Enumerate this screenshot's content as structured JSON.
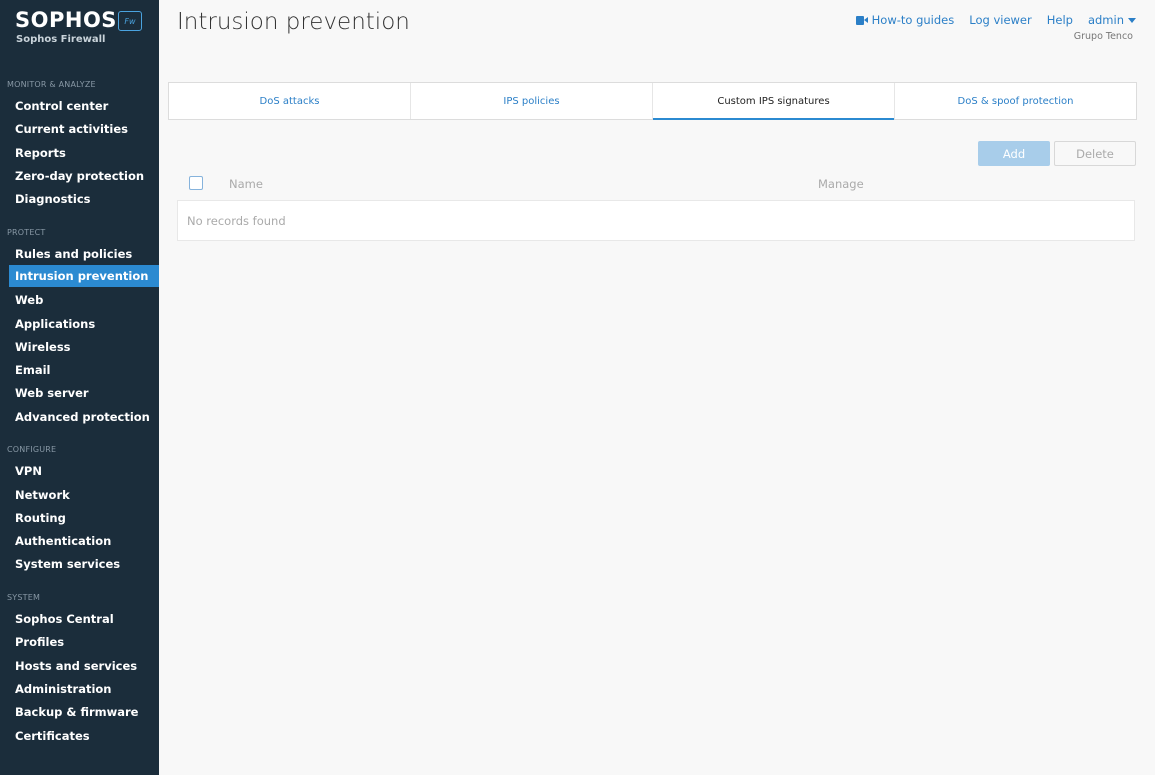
{
  "brand": {
    "name": "SOPHOS",
    "badge": "Fw",
    "product": "Sophos Firewall"
  },
  "sidebar": {
    "sections": [
      {
        "title": "MONITOR & ANALYZE",
        "items": [
          "Control center",
          "Current activities",
          "Reports",
          "Zero-day protection",
          "Diagnostics"
        ]
      },
      {
        "title": "PROTECT",
        "items": [
          "Rules and policies",
          "Intrusion prevention",
          "Web",
          "Applications",
          "Wireless",
          "Email",
          "Web server",
          "Advanced protection"
        ]
      },
      {
        "title": "CONFIGURE",
        "items": [
          "VPN",
          "Network",
          "Routing",
          "Authentication",
          "System services"
        ]
      },
      {
        "title": "SYSTEM",
        "items": [
          "Sophos Central",
          "Profiles",
          "Hosts and services",
          "Administration",
          "Backup & firmware",
          "Certificates"
        ]
      }
    ],
    "active_item": "Intrusion prevention"
  },
  "header": {
    "title": "Intrusion prevention",
    "links": {
      "howto": "How-to guides",
      "log_viewer": "Log viewer",
      "help": "Help",
      "user": "admin"
    },
    "organization": "Grupo Tenco"
  },
  "tabs": [
    {
      "label": "DoS attacks",
      "active": false
    },
    {
      "label": "IPS policies",
      "active": false
    },
    {
      "label": "Custom IPS signatures",
      "active": true
    },
    {
      "label": "DoS & spoof protection",
      "active": false
    }
  ],
  "toolbar": {
    "add_label": "Add",
    "delete_label": "Delete"
  },
  "table": {
    "columns": [
      "Name",
      "Manage"
    ],
    "empty_message": "No records found"
  },
  "colors": {
    "sidebar_bg": "#1b2d3b",
    "accent": "#2b8ad1",
    "link": "#2b7fc7"
  }
}
